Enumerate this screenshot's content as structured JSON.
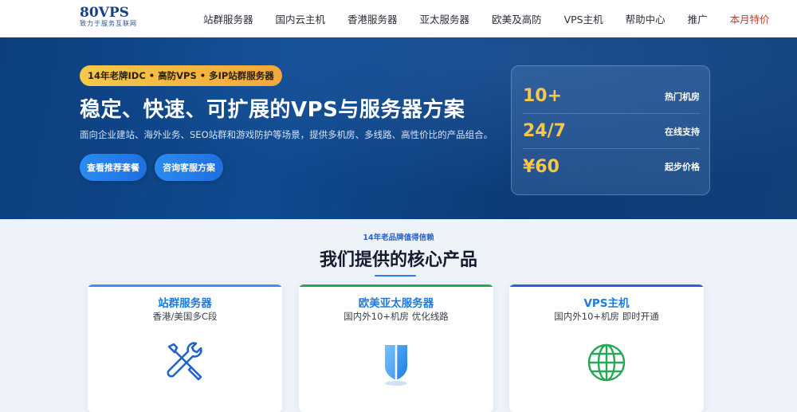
{
  "header": {
    "logo_main": "80VPS",
    "logo_sub": "致力于服务互联网",
    "nav": [
      {
        "label": "站群服务器",
        "special": false
      },
      {
        "label": "国内云主机",
        "special": false
      },
      {
        "label": "香港服务器",
        "special": false
      },
      {
        "label": "亚太服务器",
        "special": false
      },
      {
        "label": "欧美及高防",
        "special": false
      },
      {
        "label": "VPS主机",
        "special": false
      },
      {
        "label": "帮助中心",
        "special": false
      },
      {
        "label": "推广",
        "special": false
      },
      {
        "label": "本月特价",
        "special": true
      }
    ]
  },
  "hero": {
    "badge": "14年老牌IDC • 高防VPS • 多IP站群服务器",
    "title": "稳定、快速、可扩展的VPS与服务器方案",
    "desc": "面向企业建站、海外业务、SEO站群和游戏防护等场景，提供多机房、多线路、高性价比的产品组合。",
    "btn_primary": "查看推荐套餐",
    "btn_secondary": "咨询客服方案",
    "stats": [
      {
        "value": "10+",
        "label": "热门机房"
      },
      {
        "value": "24/7",
        "label": "在线支持"
      },
      {
        "value": "¥60",
        "label": "起步价格"
      }
    ]
  },
  "section": {
    "eyebrow": "14年老品牌值得信赖",
    "title": "我们提供的核心产品"
  },
  "cards": [
    {
      "title": "站群服务器",
      "sub": "香港/美国多C段",
      "icon": "tools-icon"
    },
    {
      "title": "欧美亚太服务器",
      "sub": "国内外10+机房 优化线路",
      "icon": "shield-icon"
    },
    {
      "title": "VPS主机",
      "sub": "国内外10+机房 即时开通",
      "icon": "globe-icon"
    }
  ],
  "colors": {
    "hero_bg": "#0f4a8f",
    "accent_gold": "#f6c84a",
    "primary_blue": "#1d7be0",
    "special_red": "#d8342a",
    "card2_top": "#28a857"
  }
}
